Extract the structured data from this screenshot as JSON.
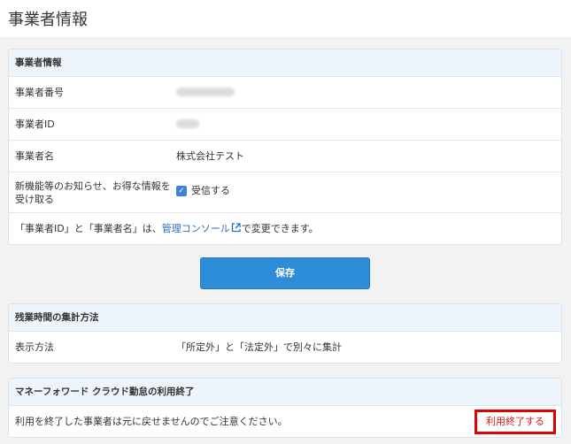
{
  "page": {
    "title": "事業者情報"
  },
  "business_panel": {
    "heading": "事業者情報",
    "rows": [
      {
        "label": "事業者番号"
      },
      {
        "label": "事業者ID"
      },
      {
        "label": "事業者名",
        "value": "株式会社テスト"
      },
      {
        "label_line1": "新機能等のお知らせ、お得な情報を",
        "label_line2": "受け取る",
        "checkbox_label": "受信する",
        "checked": true
      }
    ],
    "note": {
      "prefix": "「事業者ID」と「事業者名」は、",
      "link": "管理コンソール",
      "suffix": "で変更できます。"
    }
  },
  "save_button": {
    "label": "保存"
  },
  "overtime_panel": {
    "heading": "残業時間の集計方法",
    "row_label": "表示方法",
    "row_value": "「所定外」と「法定外」で別々に集計"
  },
  "termination_panel": {
    "heading": "マネーフォワード クラウド勤怠の利用終了",
    "text": "利用を終了した事業者は元に戻せませんのでご注意ください。",
    "button_label": "利用終了する"
  },
  "colors": {
    "accent": "#2e8dd9",
    "danger": "#e00000",
    "link": "#2a6ebb",
    "panel_head": "#eef4fb"
  }
}
